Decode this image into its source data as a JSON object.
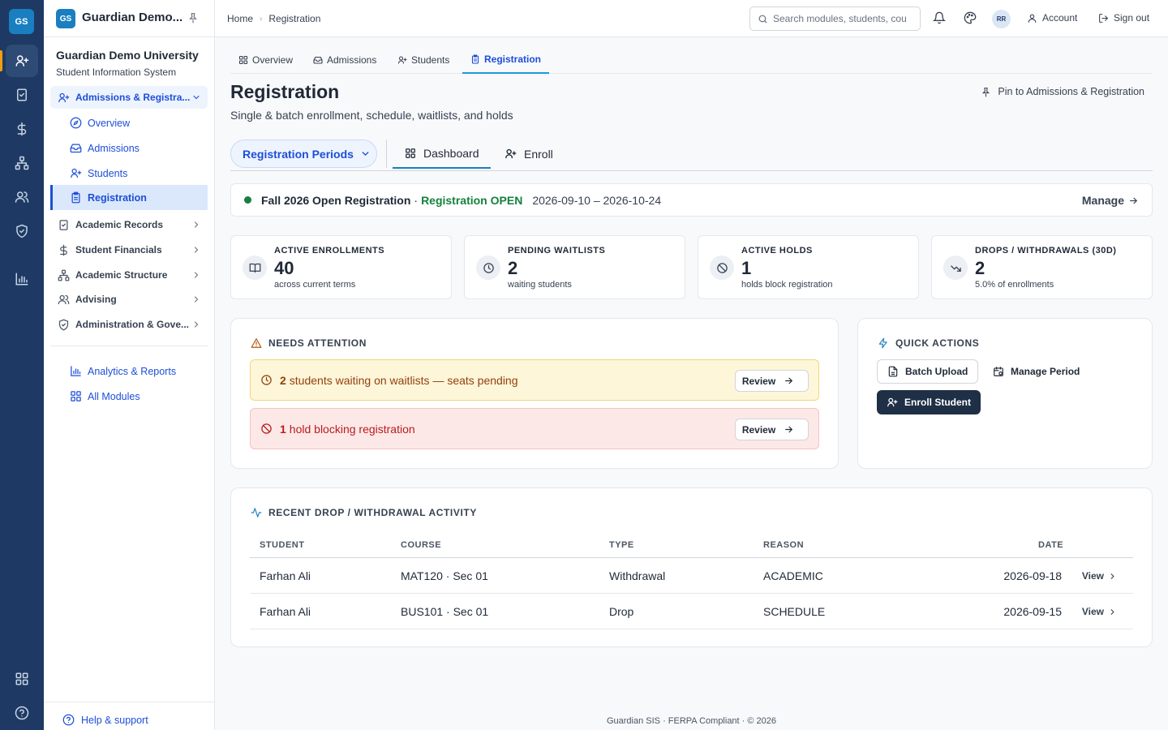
{
  "rail": {
    "logo": "GS",
    "items": [
      {
        "icon": "user-plus-icon",
        "active": true
      },
      {
        "icon": "clipboard-check-icon"
      },
      {
        "icon": "dollar-icon"
      },
      {
        "icon": "hierarchy-icon"
      },
      {
        "icon": "users-icon"
      },
      {
        "icon": "shield-check-icon"
      },
      {
        "icon": "bar-chart-icon"
      }
    ],
    "bottom": [
      {
        "icon": "grid-icon"
      },
      {
        "icon": "help-circle-icon"
      }
    ],
    "accent": "#f59e0b"
  },
  "sidebar": {
    "logo": "GS",
    "app_name": "Guardian Demo...",
    "org_name": "Guardian Demo University",
    "org_sub": "Student Information System",
    "open_group": "Admissions & Registra...",
    "sub_items": [
      {
        "label": "Overview",
        "icon": "compass-icon"
      },
      {
        "label": "Admissions",
        "icon": "inbox-icon"
      },
      {
        "label": "Students",
        "icon": "user-plus-icon"
      },
      {
        "label": "Registration",
        "icon": "clipboard-icon",
        "selected": true
      }
    ],
    "groups": [
      {
        "label": "Academic Records",
        "icon": "clipboard-check-icon"
      },
      {
        "label": "Student Financials",
        "icon": "dollar-icon"
      },
      {
        "label": "Academic Structure",
        "icon": "hierarchy-icon"
      },
      {
        "label": "Advising",
        "icon": "users-icon"
      },
      {
        "label": "Administration & Gove...",
        "icon": "shield-check-icon"
      }
    ],
    "links": [
      {
        "label": "Analytics & Reports",
        "icon": "bar-chart-icon"
      },
      {
        "label": "All Modules",
        "icon": "grid-icon"
      }
    ],
    "help": "Help & support"
  },
  "topbar": {
    "breadcrumb": [
      "Home",
      "Registration"
    ],
    "search_placeholder": "Search modules, students, cou",
    "avatar": "RR",
    "account": "Account",
    "sign_out": "Sign out"
  },
  "page_tabs": [
    {
      "label": "Overview",
      "icon": "grid-icon"
    },
    {
      "label": "Admissions",
      "icon": "inbox-icon"
    },
    {
      "label": "Students",
      "icon": "user-plus-icon"
    },
    {
      "label": "Registration",
      "icon": "clipboard-icon",
      "active": true
    }
  ],
  "page": {
    "title": "Registration",
    "subtitle": "Single & batch enrollment, schedule, waitlists, and holds",
    "pin_label": "Pin to Admissions & Registration"
  },
  "subnav": {
    "period_button": "Registration Periods",
    "tabs": [
      {
        "label": "Dashboard",
        "icon": "grid-icon",
        "active": true
      },
      {
        "label": "Enroll",
        "icon": "user-plus-icon"
      }
    ]
  },
  "period": {
    "name": "Fall 2026 Open Registration",
    "separator": "·",
    "status": "Registration OPEN",
    "dates": "2026-09-10 – 2026-10-24",
    "manage": "Manage",
    "status_color": "#15803d"
  },
  "stats": [
    {
      "label": "ACTIVE ENROLLMENTS",
      "value": "40",
      "note": "across current terms",
      "icon": "book-icon"
    },
    {
      "label": "PENDING WAITLISTS",
      "value": "2",
      "note": "waiting students",
      "icon": "clock-icon"
    },
    {
      "label": "ACTIVE HOLDS",
      "value": "1",
      "note": "holds block registration",
      "icon": "ban-icon"
    },
    {
      "label": "DROPS / WITHDRAWALS (30D)",
      "value": "2",
      "note": "5.0% of enrollments",
      "icon": "trend-down-icon"
    }
  ],
  "attention": {
    "title": "NEEDS ATTENTION",
    "items": [
      {
        "count": "2",
        "text": "students waiting on waitlists — seats pending",
        "action": "Review",
        "kind": "warning",
        "icon": "clock-icon"
      },
      {
        "count": "1",
        "text": "hold blocking registration",
        "action": "Review",
        "kind": "error",
        "icon": "ban-icon"
      }
    ]
  },
  "quick_actions": {
    "title": "QUICK ACTIONS",
    "batch_upload": "Batch Upload",
    "manage_period": "Manage Period",
    "enroll_student": "Enroll Student"
  },
  "activity": {
    "title": "RECENT DROP / WITHDRAWAL ACTIVITY",
    "columns": [
      "STUDENT",
      "COURSE",
      "TYPE",
      "REASON",
      "DATE"
    ],
    "rows": [
      {
        "student": "Farhan Ali",
        "course": "MAT120 · Sec 01",
        "type": "Withdrawal",
        "reason": "ACADEMIC",
        "date": "2026-09-18",
        "action": "View"
      },
      {
        "student": "Farhan Ali",
        "course": "BUS101 · Sec 01",
        "type": "Drop",
        "reason": "SCHEDULE",
        "date": "2026-09-15",
        "action": "View"
      }
    ]
  },
  "footer": "Guardian SIS · FERPA Compliant · © 2026"
}
